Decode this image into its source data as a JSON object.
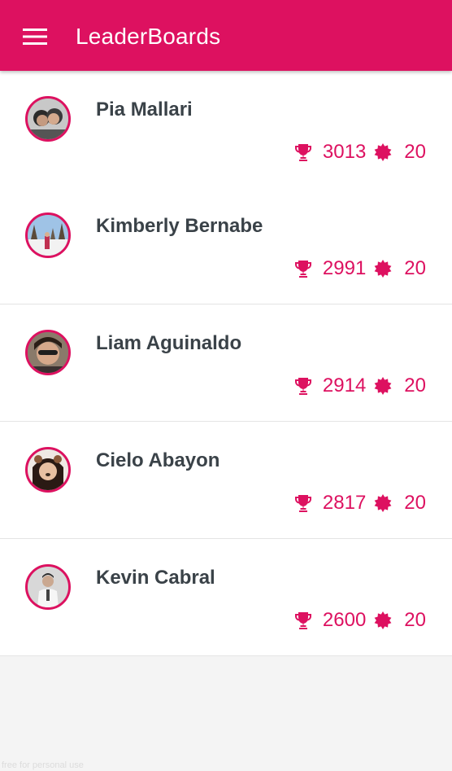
{
  "appbar": {
    "title": "LeaderBoards",
    "menu_icon": "menu-icon",
    "color": "#dd1160"
  },
  "entries": [
    {
      "name": "Pia Mallari",
      "score": "3013",
      "badges": "20"
    },
    {
      "name": "Kimberly Bernabe",
      "score": "2991",
      "badges": "20"
    },
    {
      "name": "Liam Aguinaldo",
      "score": "2914",
      "badges": "20"
    },
    {
      "name": "Cielo Abayon",
      "score": "2817",
      "badges": "20"
    },
    {
      "name": "Kevin Cabral",
      "score": "2600",
      "badges": "20"
    }
  ],
  "icons": {
    "score": "trophy-icon",
    "badge": "badge-icon"
  },
  "watermark": "free for personal use"
}
